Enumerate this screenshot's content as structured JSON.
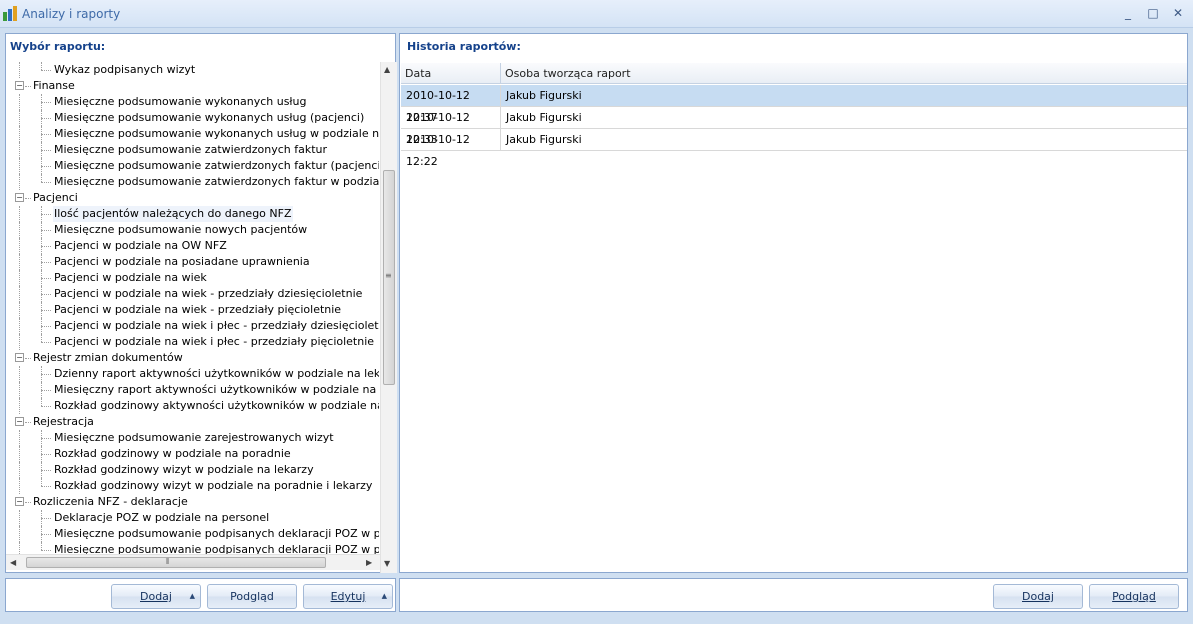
{
  "window": {
    "title": "Analizy i raporty",
    "controls": [
      "_",
      "□",
      "✕"
    ]
  },
  "left_panel": {
    "header": "Wybór raportu:",
    "tree": [
      {
        "label": "Wykaz podpisanych wizyt",
        "level": 1
      },
      {
        "label": "Finanse",
        "level": 0,
        "expanded": true
      },
      {
        "label": "Miesięczne podsumowanie wykonanych usług",
        "level": 1
      },
      {
        "label": "Miesięczne podsumowanie wykonanych usług (pacjenci)",
        "level": 1
      },
      {
        "label": "Miesięczne podsumowanie wykonanych usług w podziale na kontra",
        "level": 1
      },
      {
        "label": "Miesięczne podsumowanie zatwierdzonych faktur",
        "level": 1
      },
      {
        "label": "Miesięczne podsumowanie zatwierdzonych faktur (pacjenci)",
        "level": 1
      },
      {
        "label": "Miesięczne podsumowanie zatwierdzonych faktur w podziale na kon",
        "level": 1
      },
      {
        "label": "Pacjenci",
        "level": 0,
        "expanded": true
      },
      {
        "label": "Ilość pacjentów należących do danego NFZ",
        "level": 1,
        "selected": true
      },
      {
        "label": "Miesięczne podsumowanie nowych pacjentów",
        "level": 1
      },
      {
        "label": "Pacjenci w podziale na OW NFZ",
        "level": 1
      },
      {
        "label": "Pacjenci w podziale na posiadane uprawnienia",
        "level": 1
      },
      {
        "label": "Pacjenci w podziale na wiek",
        "level": 1
      },
      {
        "label": "Pacjenci w podziale na wiek - przedziały dziesięcioletnie",
        "level": 1
      },
      {
        "label": "Pacjenci w podziale na wiek - przedziały pięcioletnie",
        "level": 1
      },
      {
        "label": "Pacjenci w podziale na wiek i płec - przedziały dziesięcioletnie",
        "level": 1
      },
      {
        "label": "Pacjenci w podziale na wiek i płec - przedziały pięcioletnie",
        "level": 1
      },
      {
        "label": "Rejestr zmian dokumentów",
        "level": 0,
        "expanded": true
      },
      {
        "label": "Dzienny raport aktywności użytkowników w podziale na lekarzy",
        "level": 1
      },
      {
        "label": "Miesięczny raport aktywności użytkowników w podziale na lekarzy",
        "level": 1
      },
      {
        "label": "Rozkład godzinowy aktywności użytkowników w podziale na lekarzy",
        "level": 1
      },
      {
        "label": "Rejestracja",
        "level": 0,
        "expanded": true
      },
      {
        "label": "Miesięczne podsumowanie zarejestrowanych wizyt",
        "level": 1
      },
      {
        "label": "Rozkład godzinowy w podziale na poradnie",
        "level": 1
      },
      {
        "label": "Rozkład godzinowy wizyt w podziale na lekarzy",
        "level": 1
      },
      {
        "label": "Rozkład godzinowy wizyt w podziale na poradnie i lekarzy",
        "level": 1
      },
      {
        "label": "Rozliczenia NFZ - deklaracje",
        "level": 0,
        "expanded": true
      },
      {
        "label": "Deklaracje POZ w podziale na personel",
        "level": 1
      },
      {
        "label": "Miesięczne podsumowanie podpisanych deklaracji POZ w podziale n",
        "level": 1
      },
      {
        "label": "Miesięczne podsumowanie podpisanych deklaracji POZ w podziale r",
        "level": 1
      }
    ],
    "buttons": {
      "add": "Dodaj",
      "preview": "Podgląd",
      "edit": "Edytuj"
    }
  },
  "right_panel": {
    "header": "Historia raportów:",
    "columns": [
      "Data",
      "Osoba tworząca raport"
    ],
    "rows": [
      {
        "date": "2010-10-12 12:37",
        "person": "Jakub Figurski",
        "selected": true
      },
      {
        "date": "2010-10-12 12:33",
        "person": "Jakub Figurski"
      },
      {
        "date": "2010-10-12 12:22",
        "person": "Jakub Figurski"
      }
    ],
    "buttons": {
      "add": "Dodaj",
      "preview": "Podgląd"
    }
  },
  "colors": {
    "titlebar": "#dbe7f6",
    "border": "#8ba7cf",
    "header_text": "#15428b",
    "selected_row": "#c6dcf2"
  }
}
